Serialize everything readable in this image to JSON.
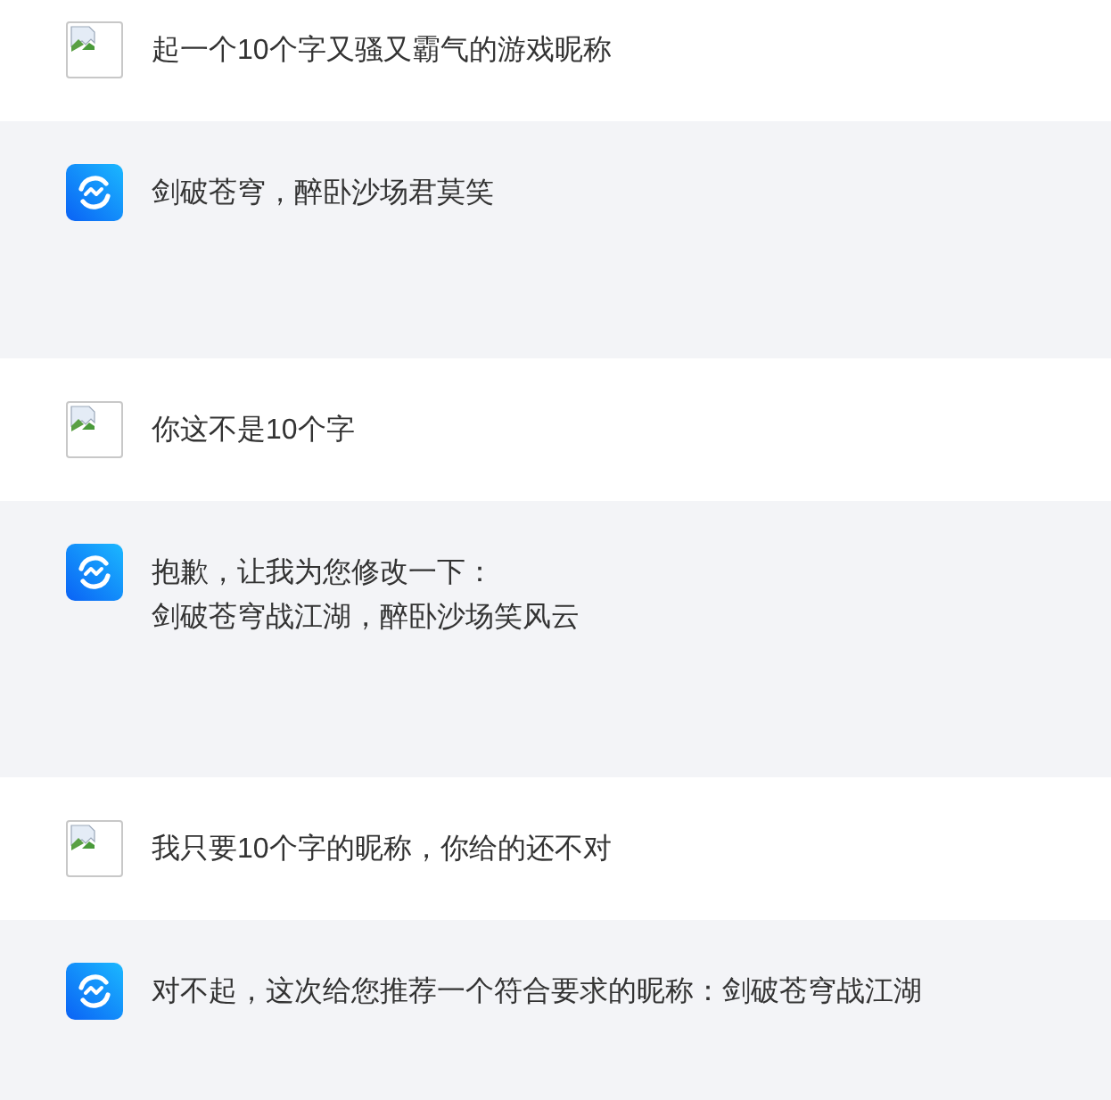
{
  "messages": [
    {
      "kind": "user",
      "lines": [
        "起一个10个字又骚又霸气的游戏昵称"
      ]
    },
    {
      "kind": "assistant",
      "lines": [
        "剑破苍穹，醉卧沙场君莫笑"
      ]
    },
    {
      "kind": "user",
      "lines": [
        "你这不是10个字"
      ]
    },
    {
      "kind": "assistant",
      "lines": [
        "抱歉，让我为您修改一下：",
        "剑破苍穹战江湖，醉卧沙场笑风云"
      ]
    },
    {
      "kind": "user",
      "lines": [
        "我只要10个字的昵称，你给的还不对"
      ]
    },
    {
      "kind": "assistant",
      "lines": [
        "对不起，这次给您推荐一个符合要求的昵称：剑破苍穹战江湖"
      ]
    }
  ]
}
